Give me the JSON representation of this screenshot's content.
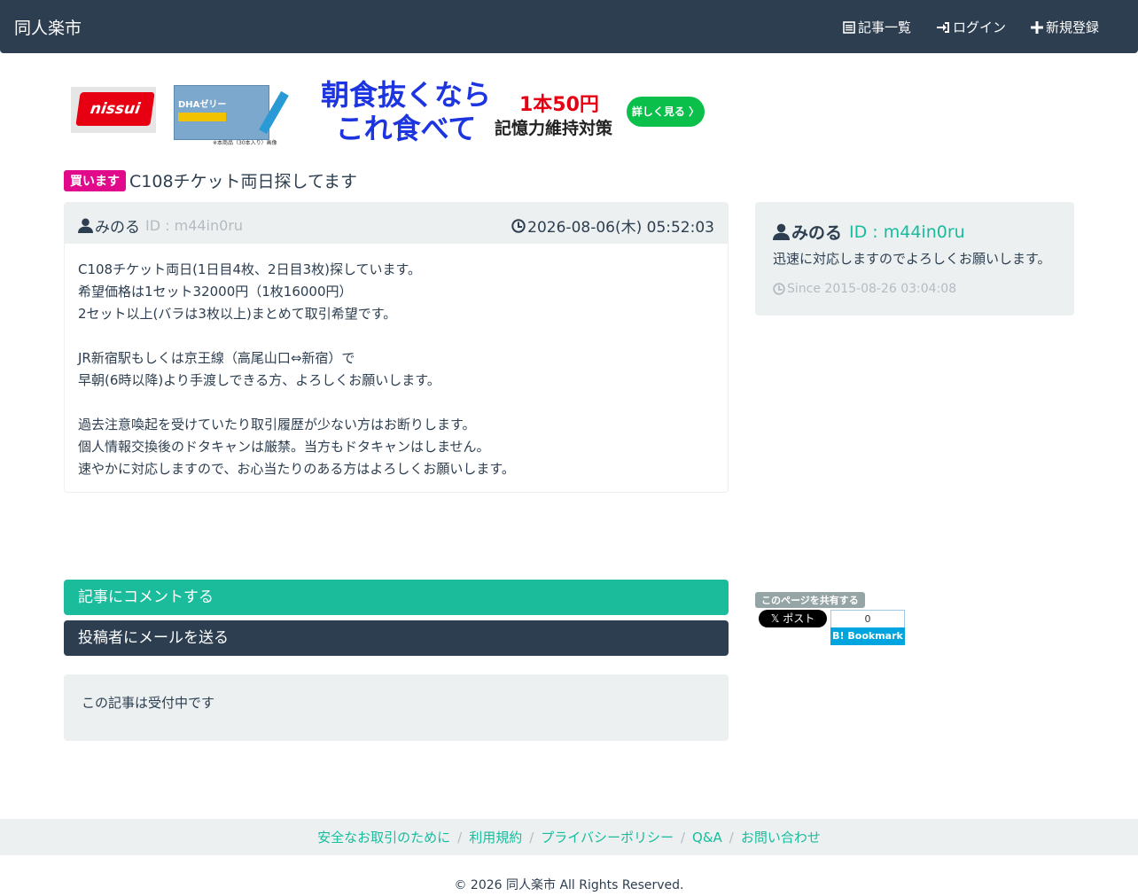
{
  "nav": {
    "brand": "同人楽市",
    "links": [
      {
        "label": "記事一覧",
        "icon": "list-icon"
      },
      {
        "label": "ログイン",
        "icon": "login-icon"
      },
      {
        "label": "新規登録",
        "icon": "plus-icon"
      }
    ]
  },
  "ad": {
    "brand": "nissui",
    "product_label": "DHAゼリー",
    "headline_line1": "朝食抜くなら",
    "headline_line2": "これ食べて",
    "price": "1本50円",
    "subline": "記憶力維持対策",
    "cta": "詳しく見る 〉",
    "note": "※本商品（30本入り）画像"
  },
  "post": {
    "badge": "買います",
    "title": "C108チケット両日探してます",
    "author": "みのる",
    "author_id": "ID : m44in0ru",
    "datetime": "2026-08-06(木) 05:52:03",
    "body_lines": [
      "C108チケット両日(1日目4枚、2日目3枚)探しています。",
      "希望価格は1セット32000円（1枚16000円）",
      "2セット以上(バラは3枚以上)まとめて取引希望です。",
      "",
      "JR新宿駅もしくは京王線（高尾山口⇔新宿）で",
      "早朝(6時以降)より手渡しできる方、よろしくお願いします。",
      "",
      "過去注意喚起を受けていたり取引履歴が少ない方はお断りします。",
      "個人情報交換後のドタキャンは厳禁。当方もドタキャンはしません。",
      "速やかに対応しますので、お心当たりのある方はよろしくお願いします。"
    ]
  },
  "profile": {
    "name": "みのる",
    "id": "ID : m44in0ru",
    "message": "迅速に対応しますのでよろしくお願いします。",
    "since": "Since 2015-08-26 03:04:08"
  },
  "actions": {
    "comment": "記事にコメントする",
    "mail": "投稿者にメールを送る",
    "status": "この記事は受付中です"
  },
  "share": {
    "label": "このページを共有する",
    "x_button": "𝕏 ポスト",
    "hatena_count": "0",
    "hatena_label": "B! Bookmark"
  },
  "footer": {
    "links": [
      "安全なお取引のために",
      "利用規約",
      "プライバシーポリシー",
      "Q&A",
      "お問い合わせ"
    ],
    "copyright": "© 2026 同人楽市 All Rights Reserved."
  }
}
